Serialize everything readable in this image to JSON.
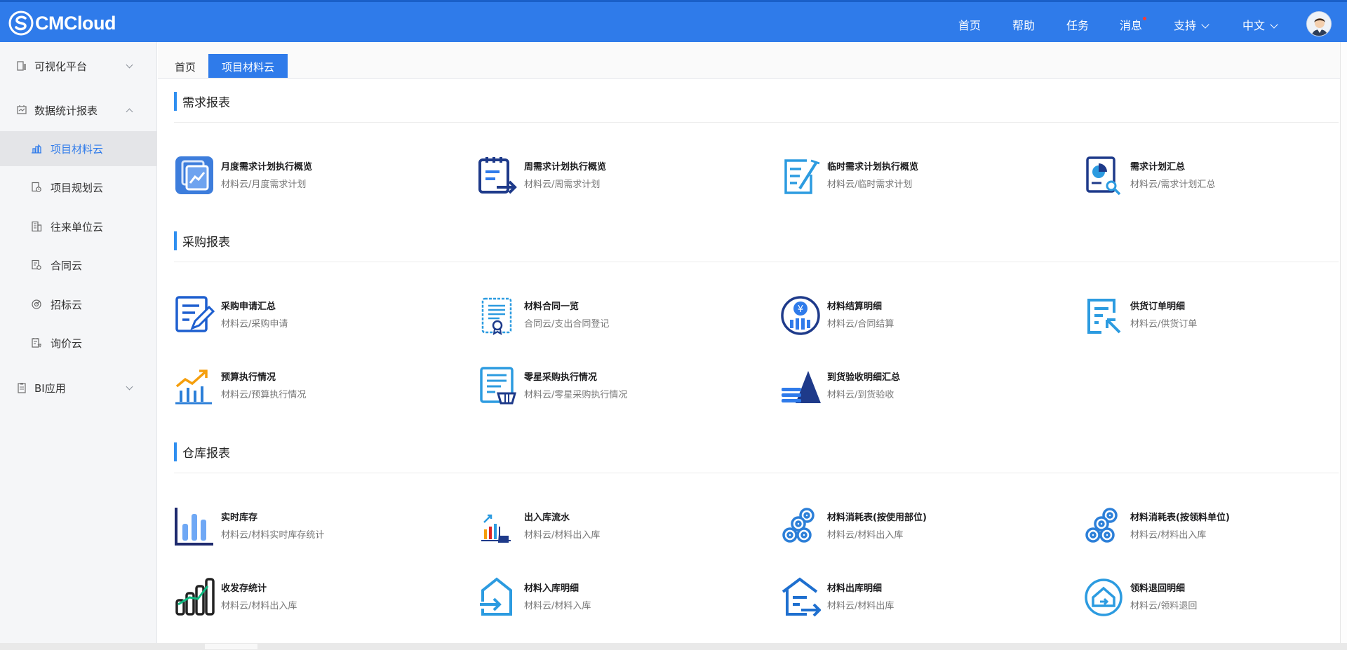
{
  "header": {
    "logo_text": "CMCloud",
    "nav": {
      "home": "首页",
      "help": "帮助",
      "tasks": "任务",
      "messages": "消息",
      "support": "支持",
      "language": "中文"
    },
    "accent_color": "#2f7bea"
  },
  "sidebar": {
    "group_visual": "可视化平台",
    "group_stats": "数据统计报表",
    "group_bi": "BI应用",
    "items": [
      {
        "label": "项目材料云",
        "icon": "chart-building-icon"
      },
      {
        "label": "项目规划云",
        "icon": "document-clock-icon"
      },
      {
        "label": "往来单位云",
        "icon": "building-icon"
      },
      {
        "label": "合同云",
        "icon": "contract-icon"
      },
      {
        "label": "招标云",
        "icon": "target-icon"
      },
      {
        "label": "询价云",
        "icon": "inquiry-icon"
      }
    ]
  },
  "tabs": {
    "home": "首页",
    "active": "项目材料云"
  },
  "sections": {
    "demand": {
      "title": "需求报表",
      "reports": [
        {
          "title": "月度需求计划执行概览",
          "path": "材料云/月度需求计划"
        },
        {
          "title": "周需求计划执行概览",
          "path": "材料云/周需求计划"
        },
        {
          "title": "临时需求计划执行概览",
          "path": "材料云/临时需求计划"
        },
        {
          "title": "需求计划汇总",
          "path": "材料云/需求计划汇总"
        }
      ]
    },
    "purchase": {
      "title": "采购报表",
      "reports": [
        {
          "title": "采购申请汇总",
          "path": "材料云/采购申请"
        },
        {
          "title": "材料合同一览",
          "path": "合同云/支出合同登记"
        },
        {
          "title": "材料结算明细",
          "path": "材料云/合同结算"
        },
        {
          "title": "供货订单明细",
          "path": "材料云/供货订单"
        },
        {
          "title": "预算执行情况",
          "path": "材料云/预算执行情况"
        },
        {
          "title": "零星采购执行情况",
          "path": "材料云/零星采购执行情况"
        },
        {
          "title": "到货验收明细汇总",
          "path": "材料云/到货验收"
        }
      ]
    },
    "warehouse": {
      "title": "仓库报表",
      "reports": [
        {
          "title": "实时库存",
          "path": "材料云/材料实时库存统计"
        },
        {
          "title": "出入库流水",
          "path": "材料云/材料出入库"
        },
        {
          "title": "材料消耗表(按使用部位)",
          "path": "材料云/材料出入库"
        },
        {
          "title": "材料消耗表(按领料单位)",
          "path": "材料云/材料出入库"
        },
        {
          "title": "收发存统计",
          "path": "材料云/材料出入库"
        },
        {
          "title": "材料入库明细",
          "path": "材料云/材料入库"
        },
        {
          "title": "材料出库明细",
          "path": "材料云/材料出库"
        },
        {
          "title": "领料退回明细",
          "path": "材料云/领料退回"
        }
      ]
    }
  }
}
